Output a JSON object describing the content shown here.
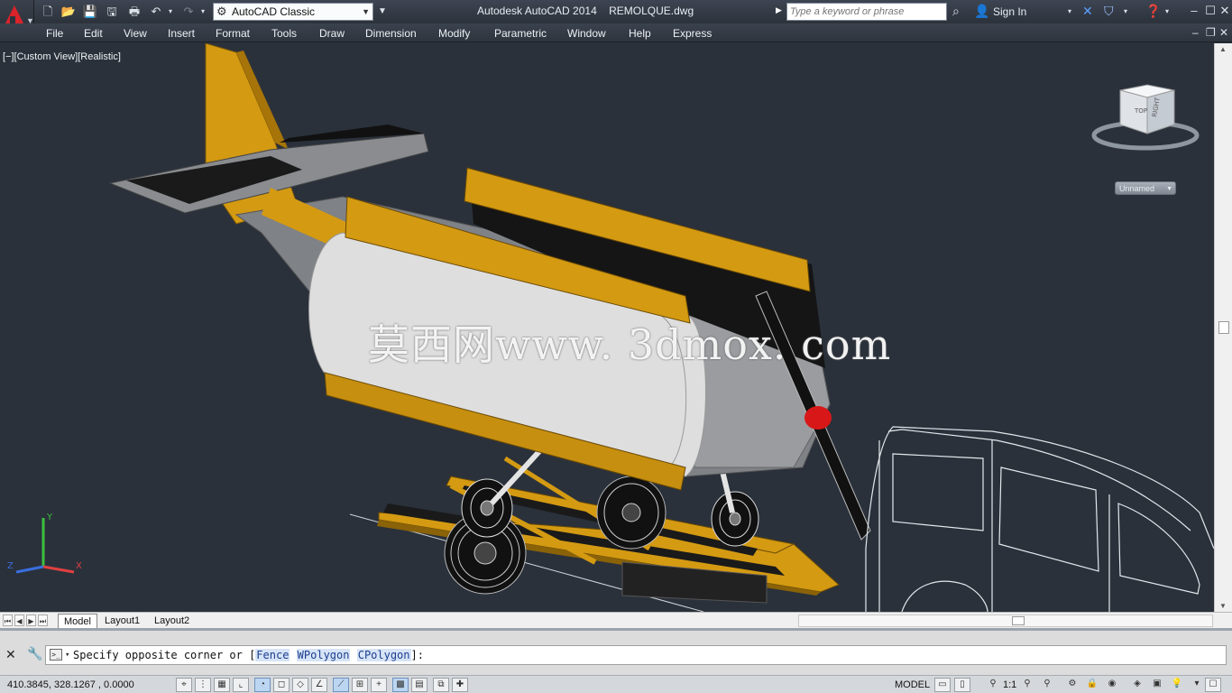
{
  "titlebar": {
    "workspace": "AutoCAD Classic",
    "app_title": "Autodesk AutoCAD 2014    REMOLQUE.dwg",
    "search_placeholder": "Type a keyword or phrase",
    "signin": "Sign In"
  },
  "menu": {
    "items": [
      "File",
      "Edit",
      "View",
      "Insert",
      "Format",
      "Tools",
      "Draw",
      "Dimension",
      "Modify",
      "Parametric",
      "Window",
      "Help",
      "Express"
    ]
  },
  "viewport": {
    "view_label": "[−][Custom View][Realistic]",
    "watermark": "莫西网www. 3dmox. com",
    "viewcube": {
      "top": "TOP",
      "right": "RIGHT"
    },
    "view_name": "Unnamed",
    "ucs": {
      "x": "X",
      "y": "Y",
      "z": "Z"
    }
  },
  "tabs": {
    "items": [
      "Model",
      "Layout1",
      "Layout2"
    ]
  },
  "command": {
    "prompt_before": "Specify opposite corner or [",
    "options": [
      {
        "key": "Fence",
        "label": "Fence"
      },
      {
        "key": "W",
        "label": "WPolygon",
        "rest": "Polygon"
      },
      {
        "key": "C",
        "label": "CPolygon",
        "rest": "Polygon"
      }
    ],
    "opt_fence": "Fence",
    "opt_w_key": "W",
    "opt_w_rest": "Polygon",
    "opt_c_key": "C",
    "opt_c_rest": "Polygon",
    "prompt_after": "]:"
  },
  "statusbar": {
    "coords": "410.3845, 328.1267 , 0.0000",
    "model": "MODEL",
    "scale": "1:1"
  },
  "colors": {
    "accent_red": "#d8242a",
    "viewport_bg": "#2a313b",
    "yellow_part": "#d49a12",
    "gray_part": "#8a8c90"
  }
}
